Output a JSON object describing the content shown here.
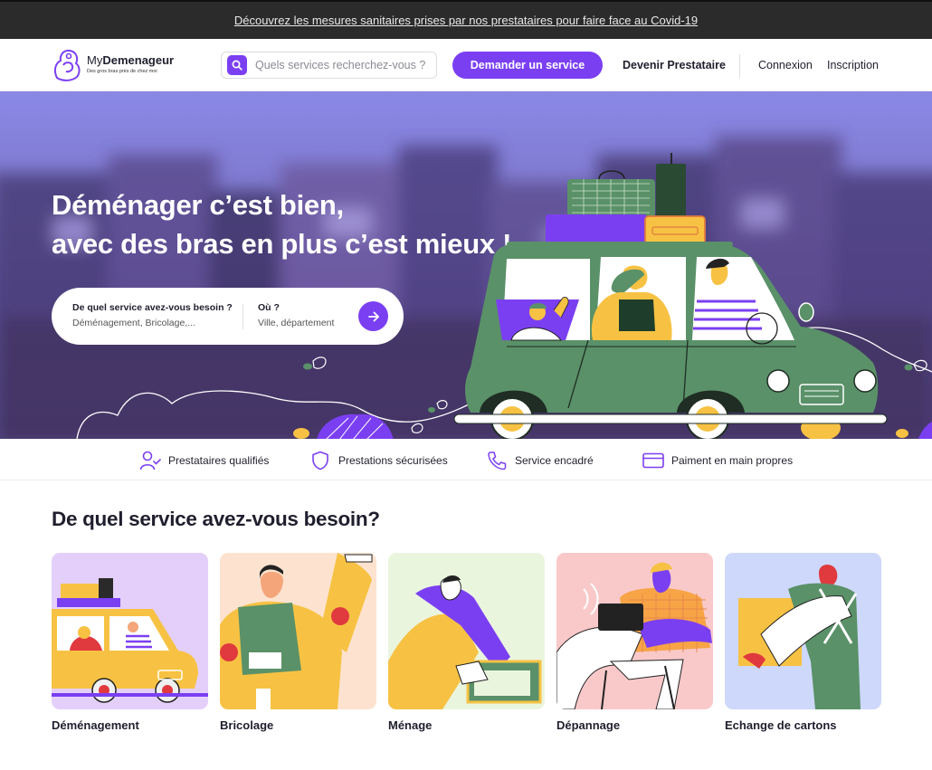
{
  "banner": {
    "text": "Découvrez les mesures sanitaires prises par nos prestataires pour faire face au Covid-19"
  },
  "header": {
    "logo_prefix": "My",
    "logo_bold": "Demenageur",
    "tagline": "Des gros bras près de chez moi",
    "search_placeholder": "Quels services recherchez-vous ?",
    "cta_label": "Demander un service",
    "become_provider": "Devenir Prestataire",
    "login": "Connexion",
    "signup": "Inscription"
  },
  "hero": {
    "title_line1": "Déménager c’est bien,",
    "title_line2": "avec des bras en plus c’est mieux !",
    "form": {
      "service_label": "De quel service avez-vous besoin ?",
      "service_placeholder": "Déménagement, Bricolage,...",
      "where_label": "Où ?",
      "where_placeholder": "Ville, département"
    }
  },
  "features": [
    {
      "label": "Prestataires qualifiés",
      "icon": "user-check-icon"
    },
    {
      "label": "Prestations sécurisées",
      "icon": "shield-icon"
    },
    {
      "label": "Service encadré",
      "icon": "phone-icon"
    },
    {
      "label": "Paiment en main propres",
      "icon": "credit-card-icon"
    }
  ],
  "services": {
    "title": "De quel service avez-vous besoin?",
    "items": [
      {
        "label": "Déménagement",
        "bg": "#e4cffa"
      },
      {
        "label": "Bricolage",
        "bg": "#fde3cf"
      },
      {
        "label": "Ménage",
        "bg": "#eaf5de"
      },
      {
        "label": "Dépannage",
        "bg": "#f9c9c9"
      },
      {
        "label": "Echange de cartons",
        "bg": "#cdd8fb"
      }
    ]
  },
  "colors": {
    "accent": "#7b3ff2",
    "car_green": "#5a9168",
    "yellow": "#f7c243"
  }
}
